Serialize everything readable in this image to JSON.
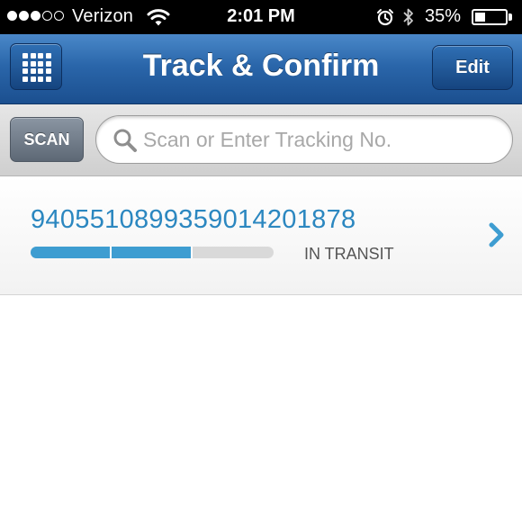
{
  "status_bar": {
    "carrier": "Verizon",
    "time": "2:01 PM",
    "battery_percent_label": "35%",
    "battery_level": 0.35,
    "signal_bars_filled": 3,
    "signal_bars_total": 5
  },
  "nav": {
    "title": "Track & Confirm",
    "edit_label": "Edit"
  },
  "search": {
    "scan_label": "SCAN",
    "placeholder": "Scan or Enter Tracking No.",
    "value": ""
  },
  "tracking_items": [
    {
      "number": "9405510899359014201878",
      "status": "IN TRANSIT",
      "progress_steps_completed": 2,
      "progress_steps_total": 3
    }
  ],
  "colors": {
    "nav_blue": "#2a66aa",
    "tracking_number": "#2b87c0",
    "progress_fill": "#3e9dd1",
    "progress_track": "#d9d9d9"
  },
  "icons": {
    "menu": "grid-icon",
    "search": "search-icon",
    "disclosure": "chevron-right-icon",
    "wifi": "wifi-icon",
    "alarm": "alarm-icon",
    "bluetooth": "bluetooth-icon",
    "battery": "battery-icon"
  }
}
